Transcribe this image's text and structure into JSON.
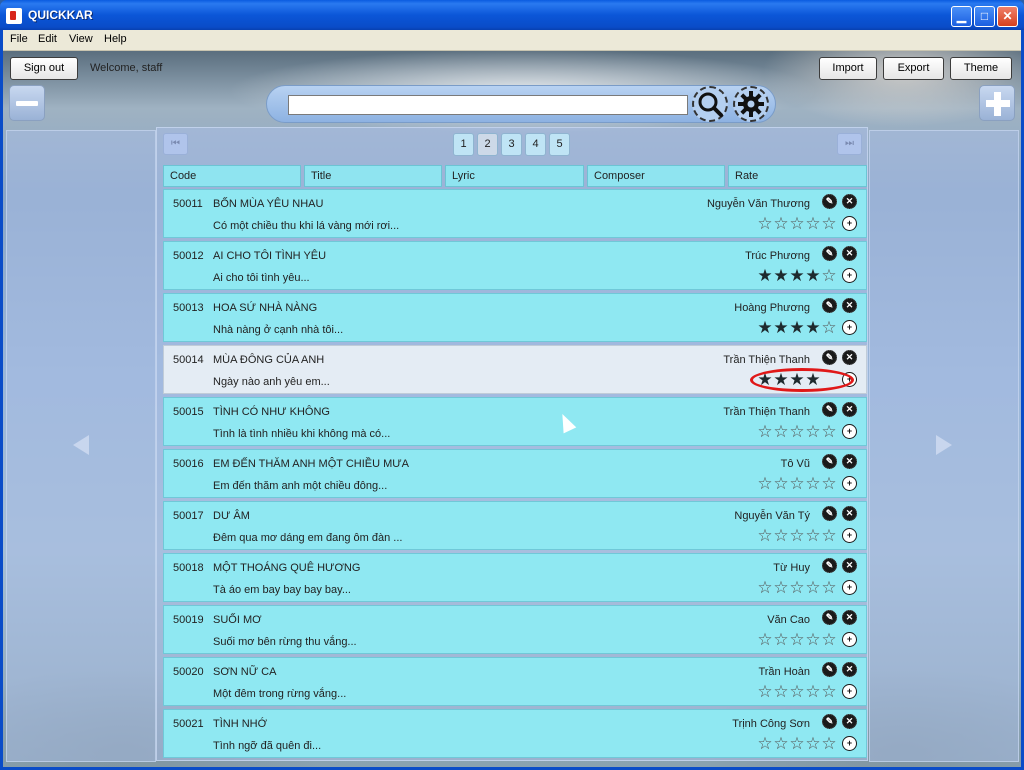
{
  "window": {
    "title": "QUICKKAR",
    "min_symbol": "▁",
    "max_symbol": "□",
    "close_symbol": "✕"
  },
  "menu": [
    "File",
    "Edit",
    "View",
    "Help"
  ],
  "toolbar": {
    "sign_out": "Sign out",
    "welcome": "Welcome, staff",
    "import": "Import",
    "export": "Export",
    "theme": "Theme"
  },
  "search": {
    "value": "",
    "placeholder": ""
  },
  "pagination": {
    "first_symbol": "⏮",
    "last_symbol": "⏭",
    "pages": [
      "1",
      "2",
      "3",
      "4",
      "5"
    ],
    "current": "2"
  },
  "columns": [
    "Code",
    "Title",
    "Lyric",
    "Composer",
    "Rate"
  ],
  "songs": [
    {
      "code": "50011",
      "title": "BỐN MÙA YÊU NHAU",
      "lyric": "Có một chiều thu khi lá vàng mới rơi...",
      "composer": "Nguyễn Văn Thương",
      "rating": 0
    },
    {
      "code": "50012",
      "title": "AI CHO TÔI TÌNH YÊU",
      "lyric": "Ai cho tôi tình yêu...",
      "composer": "Trúc Phương",
      "rating": 4
    },
    {
      "code": "50013",
      "title": "HOA SỨ NHÀ NÀNG",
      "lyric": "Nhà nàng ở cạnh nhà tôi...",
      "composer": "Hoàng Phương",
      "rating": 4
    },
    {
      "code": "50014",
      "title": "MÙA ĐÔNG CỦA ANH",
      "lyric": "Ngày nào anh yêu em...",
      "composer": "Trần Thiện Thanh",
      "rating": 4,
      "selected": true
    },
    {
      "code": "50015",
      "title": "TÌNH CÓ NHƯ KHÔNG",
      "lyric": "Tình là tình nhiều khi không mà có...",
      "composer": "Trần Thiện Thanh",
      "rating": 0
    },
    {
      "code": "50016",
      "title": "EM ĐẾN THĂM ANH MỘT CHIỀU MƯA",
      "lyric": "Em đến thăm anh một chiều đông...",
      "composer": "Tô Vũ",
      "rating": 0
    },
    {
      "code": "50017",
      "title": "DƯ ÂM",
      "lyric": "Đêm qua mơ dáng em đang ôm đàn ...",
      "composer": "Nguyễn Văn Tý",
      "rating": 0
    },
    {
      "code": "50018",
      "title": "MỘT THOÁNG QUÊ HƯƠNG",
      "lyric": "Tà áo em bay bay bay bay...",
      "composer": "Từ Huy",
      "rating": 0
    },
    {
      "code": "50019",
      "title": "SUỐI MƠ",
      "lyric": "Suối mơ bên rừng thu vắng...",
      "composer": "Văn Cao",
      "rating": 0
    },
    {
      "code": "50020",
      "title": "SƠN NỮ CA",
      "lyric": "Một đêm trong rừng vắng...",
      "composer": "Trần Hoàn",
      "rating": 0
    },
    {
      "code": "50021",
      "title": "TÌNH NHỚ",
      "lyric": "Tình ngỡ đã quên đi...",
      "composer": "Trịnh Công Sơn",
      "rating": 0
    }
  ],
  "colors": {
    "row": "#8fe8f2",
    "selected_row": "#e4ecf4",
    "highlight_ring": "#e01818",
    "titlebar": "#0a5be0"
  }
}
